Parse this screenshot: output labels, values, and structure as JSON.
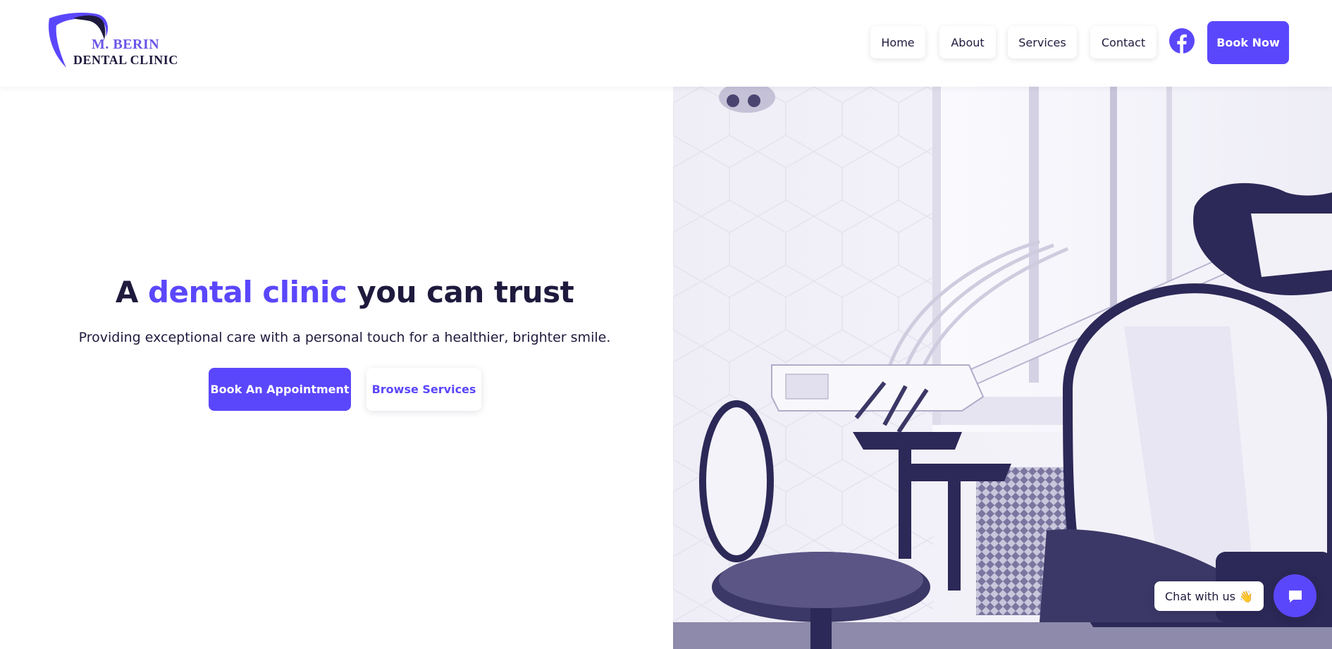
{
  "brand": {
    "name_line1": "M. BERIN",
    "name_line2": "DENTAL CLINIC",
    "primary_color": "#5b47fb",
    "text_color": "#1e1a3d"
  },
  "nav": {
    "items": [
      {
        "label": "Home"
      },
      {
        "label": "About"
      },
      {
        "label": "Services"
      },
      {
        "label": "Contact"
      }
    ],
    "social_icon": "facebook-icon",
    "cta_label": "Book Now"
  },
  "hero": {
    "title_before": "A",
    "title_accent": "dental clinic",
    "title_after": "you can trust",
    "subtitle": "Providing exceptional care with a personal touch for a healthier, brighter smile.",
    "primary_button": "Book An Appointment",
    "secondary_button": "Browse Services",
    "image_subject": "dental chair in clinic room"
  },
  "chat": {
    "label": "Chat with us",
    "emoji": "👋",
    "icon": "chat-bubble-icon"
  }
}
